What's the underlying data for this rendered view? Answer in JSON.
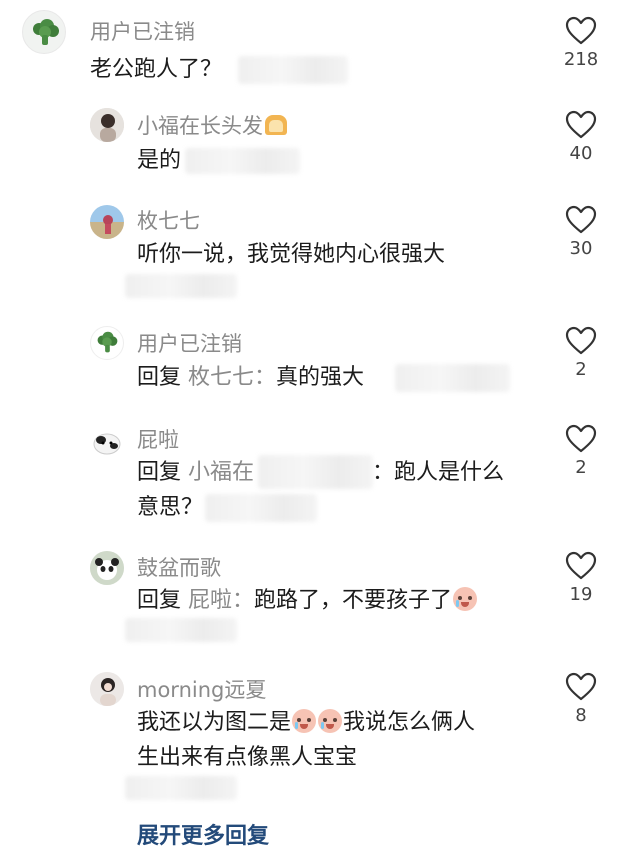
{
  "comments": [
    {
      "username": "用户已注销",
      "text": "老公跑人了？",
      "likes": "218"
    },
    {
      "username": "小福在长头发",
      "text": "是的",
      "likes": "40"
    },
    {
      "username": "枚七七",
      "text": "听你一说，我觉得她内心很强大",
      "likes": "30"
    },
    {
      "username": "用户已注销",
      "reply_prefix": "回复",
      "reply_to": "枚七七：",
      "text": "真的强大",
      "likes": "2"
    },
    {
      "username": "屁啦",
      "reply_prefix": "回复",
      "reply_to": "小福在",
      "text_line1": "：跑人是什么",
      "text_line2": "意思？",
      "likes": "2"
    },
    {
      "username": "鼓盆而歌",
      "reply_prefix": "回复",
      "reply_to": "屁啦：",
      "text": "跑路了，不要孩子了",
      "likes": "19"
    },
    {
      "username": "morning远夏",
      "text_part1": "我还以为图二是",
      "text_part2": "我说怎么俩人",
      "text_line2": "生出来有点像黑人宝宝",
      "likes": "8"
    }
  ],
  "expand_label": "展开更多回复",
  "icons": {
    "like": "heart-outline-icon",
    "crying": "crying-face-emoji",
    "bread": "bread-emoji"
  },
  "colors": {
    "username": "#8a8a8a",
    "expand": "#234a7a"
  }
}
